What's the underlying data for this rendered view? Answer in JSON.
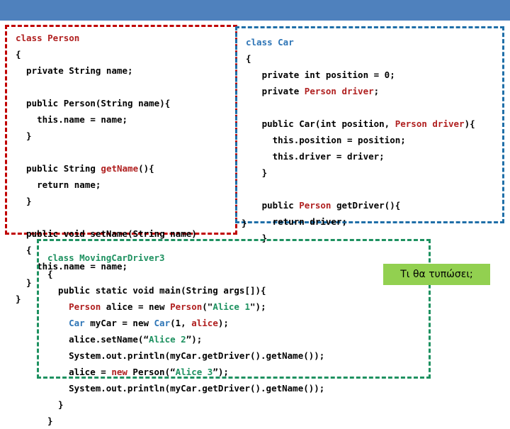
{
  "banner": {
    "color": "#4F81BD"
  },
  "boxes": {
    "person": {
      "border_color": "#C00000",
      "title": "class Person",
      "code": "class Person\n{\n  private String name;\n\n  public Person(String name){\n    this.name = name;\n  }\n\n  public String getName(){\n    return name;\n  }\n\n  public void setName(String name)\n  {\n    this.name = name;\n  }\n}"
    },
    "car": {
      "border_color": "#1F6FA8",
      "title": "class Car",
      "code": "class Car\n{\n   private int position = 0;\n   private Person driver;\n\n   public Car(int position, Person driver){\n     this.position = position;\n     this.driver = driver;\n   }\n\n   public Person getDriver(){\n     return driver;\n   }\n }",
      "trailing_brace": "}"
    },
    "driver": {
      "border_color": "#1E9160",
      "title": "class MovingCarDriver3",
      "code": "class MovingCarDriver3\n{\n  public static void main(String args[]){\n    Person alice = new Person(\"Alice 1\");\n    Car myCar = new Car(1, alice);\n    alice.setName(“Alice 2”);\n    System.out.println(myCar.getDriver().getName());\n    alice = new Person(“Alice 3”);\n    System.out.println(myCar.getDriver().getName());\n  }\n}"
    }
  },
  "callout": {
    "text": "Τι θα τυπώσει;",
    "background": "#92D050"
  }
}
